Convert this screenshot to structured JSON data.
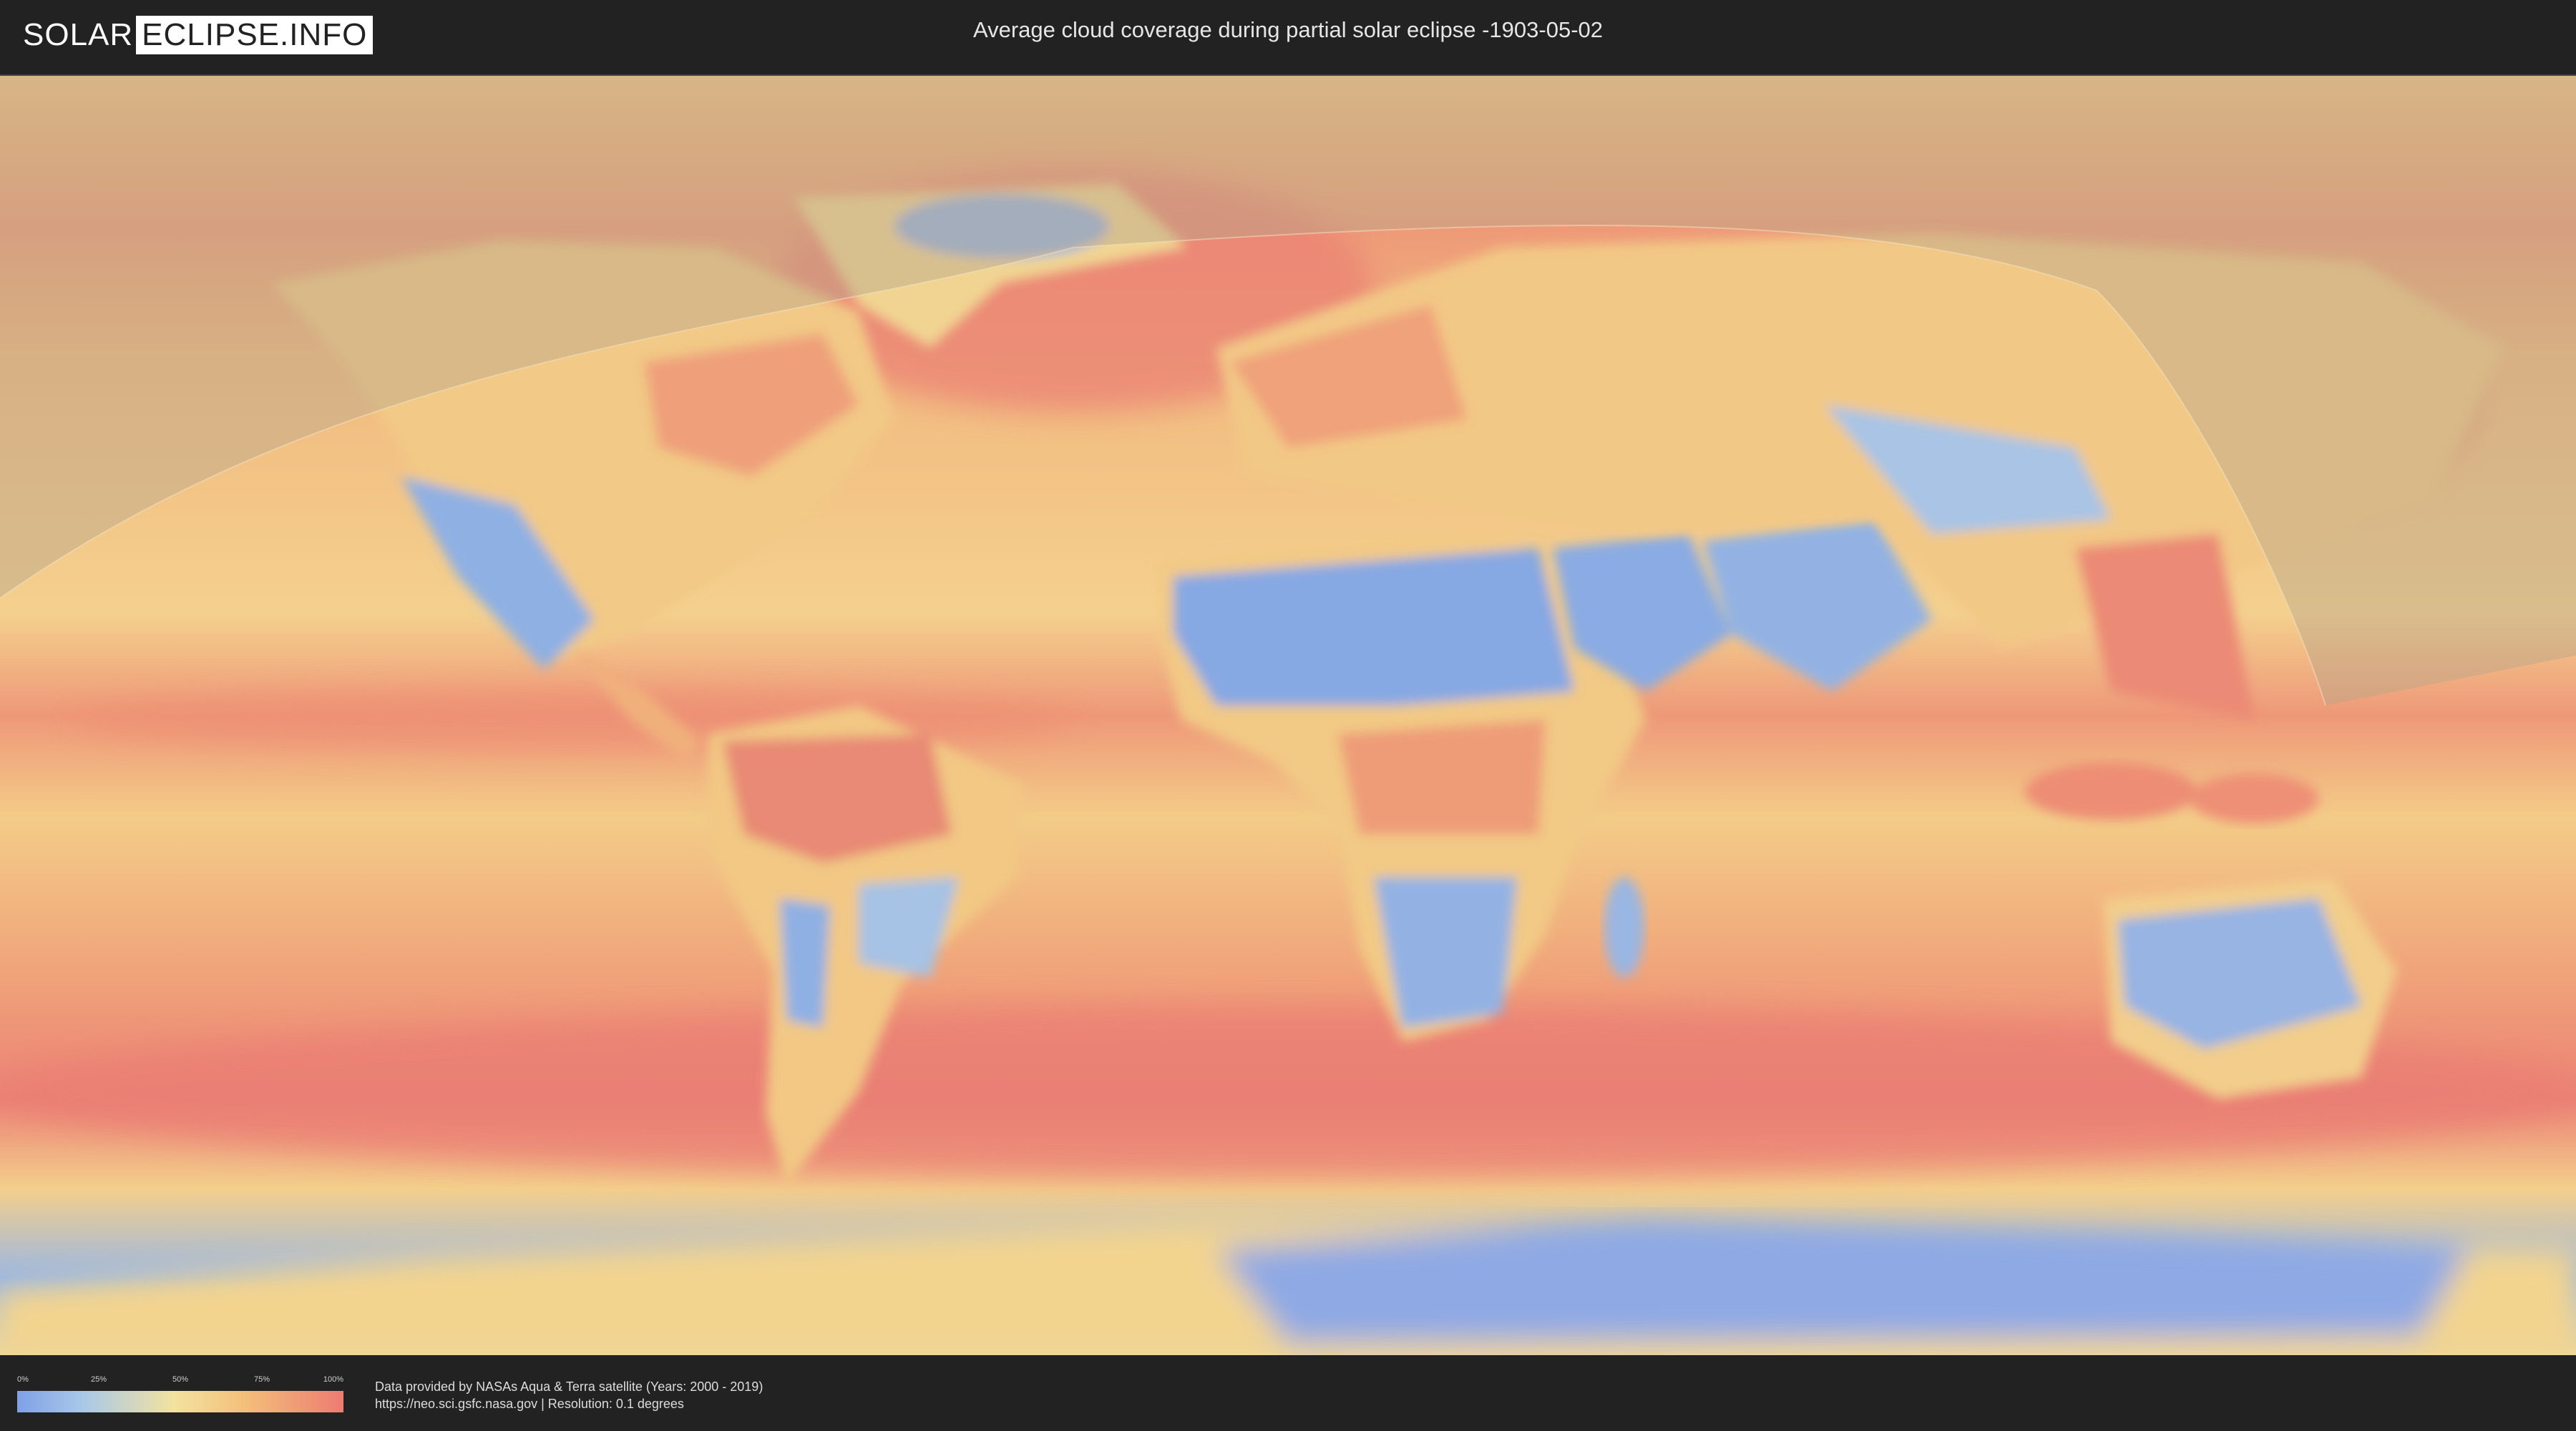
{
  "header": {
    "logo_part1": "SOLAR",
    "logo_part2": "ECLIPSE.INFO",
    "title": "Average cloud coverage during partial solar eclipse -1903-05-02"
  },
  "legend": {
    "ticks": [
      "0%",
      "25%",
      "50%",
      "75%",
      "100%"
    ],
    "colors": {
      "low": "#7fa0e6",
      "mid_low": "#a9c8e8",
      "mid": "#f3e2a0",
      "mid_high": "#f3bf7a",
      "high": "#ed7b72"
    }
  },
  "footer": {
    "credit_line1": "Data provided by NASAs Aqua & Terra satellite (Years: 2000 - 2019)",
    "credit_line2": "https://neo.sci.gsfc.nasa.gov | Resolution: 0.1 degrees"
  },
  "map": {
    "eclipse_visibility_overlay": "partial eclipse visibility zone (northern hemisphere)",
    "colors": {
      "ocean_base": "#f1c27f",
      "cloudy": "#eb8477",
      "clear": "#8fb0e3",
      "overlay": "#b9a78a"
    }
  }
}
